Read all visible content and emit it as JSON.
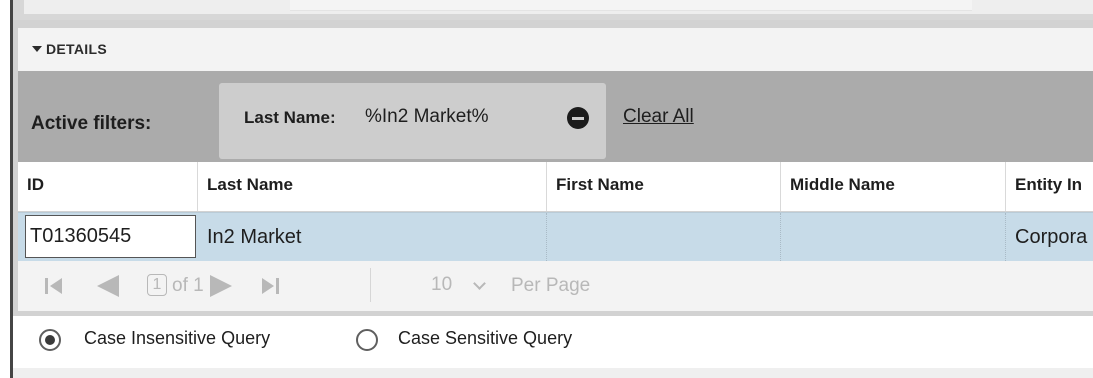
{
  "details": {
    "label": "DETAILS"
  },
  "filters": {
    "active_label": "Active filters:",
    "chip": {
      "label": "Last Name:",
      "value": "%In2 Market%"
    },
    "clear_all": "Clear All"
  },
  "table": {
    "columns": [
      "ID",
      "Last Name",
      "First Name",
      "Middle Name",
      "Entity In"
    ],
    "rows": [
      {
        "id": "T01360545",
        "last_name": "In2 Market",
        "first_name": "",
        "middle_name": "",
        "entity": "Corpora"
      }
    ]
  },
  "pager": {
    "page": "1",
    "of_text": "of 1",
    "page_size": "10",
    "per_page": "Per Page"
  },
  "query_options": {
    "selected": "case-insensitive",
    "case_insensitive": "Case Insensitive Query",
    "case_sensitive": "Case Sensitive Query"
  }
}
